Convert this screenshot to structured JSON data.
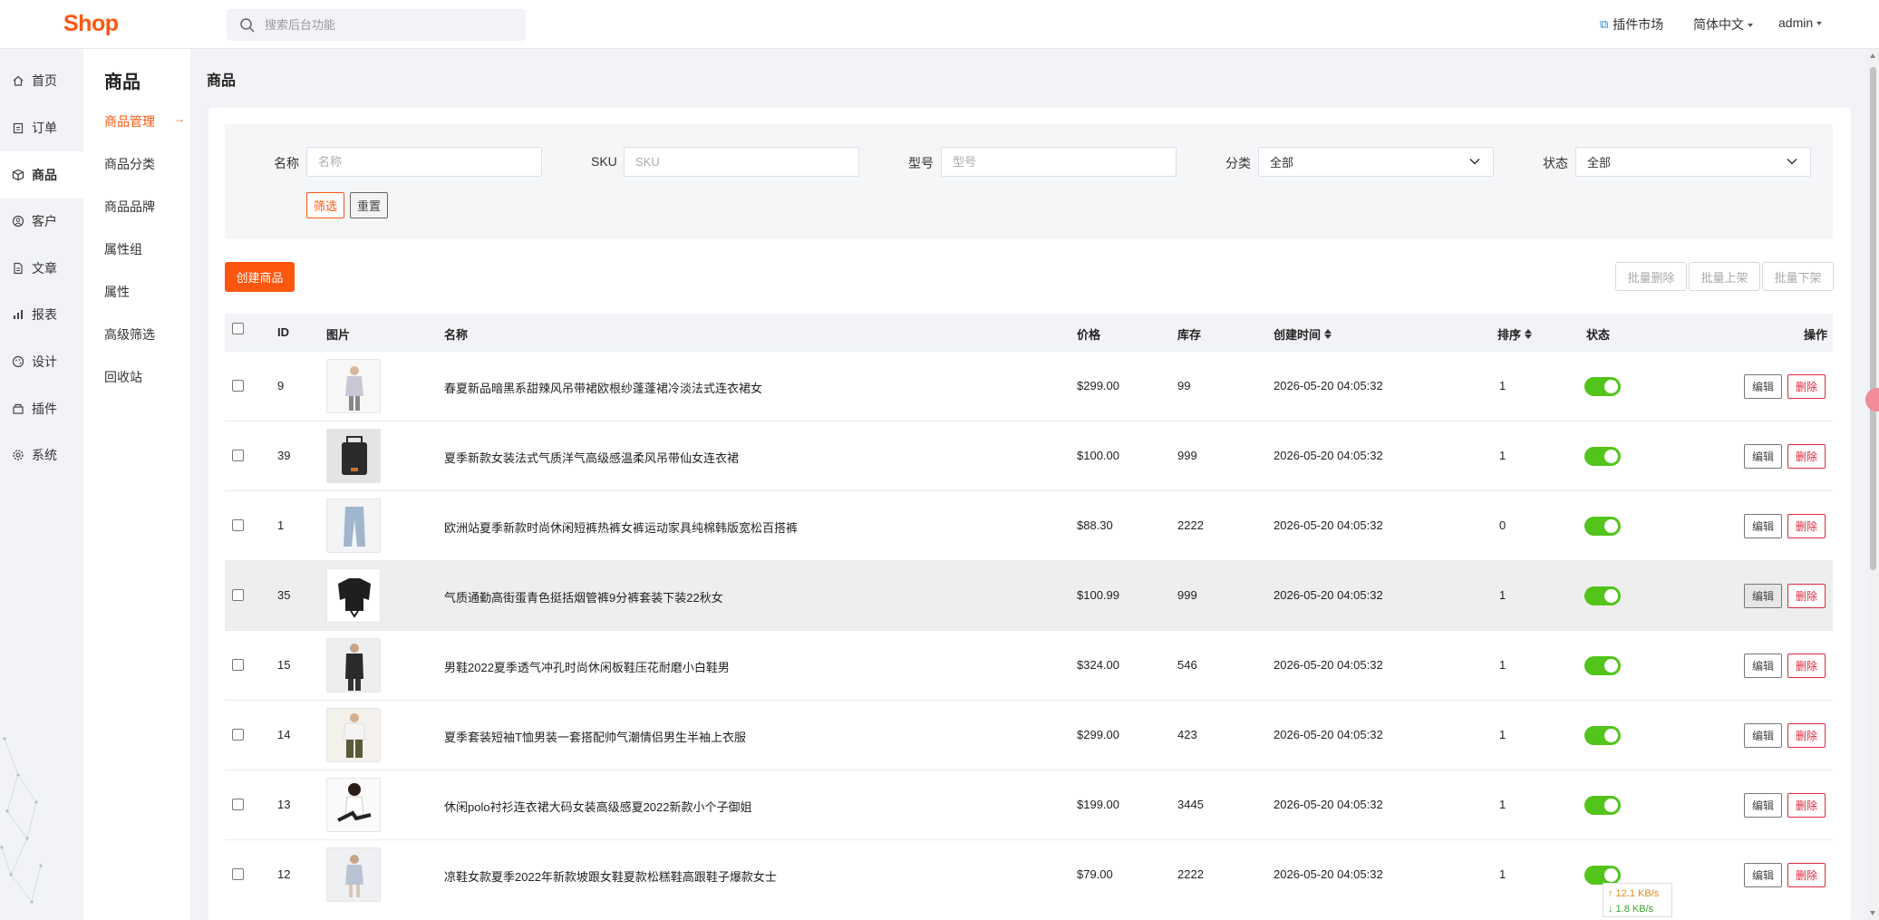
{
  "header": {
    "logo": "Shop",
    "search_placeholder": "搜索后台功能",
    "plugin_market": "插件市场",
    "language": "简体中文",
    "user": "admin"
  },
  "sidebar": {
    "items": [
      {
        "label": "首页",
        "icon": "home-icon"
      },
      {
        "label": "订单",
        "icon": "clipboard-icon"
      },
      {
        "label": "商品",
        "icon": "box-icon",
        "active": true
      },
      {
        "label": "客户",
        "icon": "user-circle-icon"
      },
      {
        "label": "文章",
        "icon": "document-icon"
      },
      {
        "label": "报表",
        "icon": "bar-chart-icon"
      },
      {
        "label": "设计",
        "icon": "palette-icon"
      },
      {
        "label": "插件",
        "icon": "plugin-icon"
      },
      {
        "label": "系统",
        "icon": "gear-icon"
      }
    ]
  },
  "subsidebar": {
    "title": "商品",
    "items": [
      {
        "label": "商品管理",
        "active": true
      },
      {
        "label": "商品分类"
      },
      {
        "label": "商品品牌"
      },
      {
        "label": "属性组"
      },
      {
        "label": "属性"
      },
      {
        "label": "高级筛选"
      },
      {
        "label": "回收站"
      }
    ],
    "arrow": "→"
  },
  "page": {
    "title": "商品"
  },
  "filter": {
    "name_label": "名称",
    "name_placeholder": "名称",
    "sku_label": "SKU",
    "sku_placeholder": "SKU",
    "model_label": "型号",
    "model_placeholder": "型号",
    "category_label": "分类",
    "category_value": "全部",
    "status_label": "状态",
    "status_value": "全部",
    "filter_button": "筛选",
    "reset_button": "重置"
  },
  "toolbar": {
    "create": "创建商品",
    "batch_delete": "批量删除",
    "batch_on": "批量上架",
    "batch_off": "批量下架"
  },
  "table": {
    "headers": {
      "id": "ID",
      "image": "图片",
      "name": "名称",
      "price": "价格",
      "stock": "库存",
      "created": "创建时间",
      "sort": "排序",
      "status": "状态",
      "actions": "操作"
    },
    "edit_label": "编辑",
    "delete_label": "删除",
    "rows": [
      {
        "id": "9",
        "name": "春夏新品暗黑系甜辣风吊带裙欧根纱蓬蓬裙冷淡法式连衣裙女",
        "price": "$299.00",
        "stock": "99",
        "created": "2026-05-20 04:05:32",
        "sort": "1",
        "status": true
      },
      {
        "id": "39",
        "name": "夏季新款女装法式气质洋气高级感温柔风吊带仙女连衣裙",
        "price": "$100.00",
        "stock": "999",
        "created": "2026-05-20 04:05:32",
        "sort": "1",
        "status": true
      },
      {
        "id": "1",
        "name": "欧洲站夏季新款时尚休闲短裤热裤女裤运动家具纯棉韩版宽松百搭裤",
        "price": "$88.30",
        "stock": "2222",
        "created": "2026-05-20 04:05:32",
        "sort": "0",
        "status": true
      },
      {
        "id": "35",
        "name": "气质通勤高街蛋青色挺括烟管裤9分裤套装下装22秋女",
        "price": "$100.99",
        "stock": "999",
        "created": "2026-05-20 04:05:32",
        "sort": "1",
        "status": true
      },
      {
        "id": "15",
        "name": "男鞋2022夏季透气冲孔时尚休闲板鞋压花耐磨小白鞋男",
        "price": "$324.00",
        "stock": "546",
        "created": "2026-05-20 04:05:32",
        "sort": "1",
        "status": true
      },
      {
        "id": "14",
        "name": "夏季套装短袖T恤男装一套搭配帅气潮情侣男生半袖上衣服",
        "price": "$299.00",
        "stock": "423",
        "created": "2026-05-20 04:05:32",
        "sort": "1",
        "status": true
      },
      {
        "id": "13",
        "name": "休闲polo衬衫连衣裙大码女装高级感夏2022新款小个子御姐",
        "price": "$199.00",
        "stock": "3445",
        "created": "2026-05-20 04:05:32",
        "sort": "1",
        "status": true
      },
      {
        "id": "12",
        "name": "凉鞋女款夏季2022年新款坡跟女鞋夏款松糕鞋高跟鞋子爆款女士",
        "price": "$79.00",
        "stock": "2222",
        "created": "2026-05-20 04:05:32",
        "sort": "1",
        "status": true
      }
    ]
  },
  "netspeed": {
    "up": "↑ 12.1 KB/s",
    "down": "↓ 1.8 KB/s"
  },
  "colors": {
    "brand": "#fd560f",
    "toggle_on": "#52c41a",
    "danger": "#e0283c"
  }
}
